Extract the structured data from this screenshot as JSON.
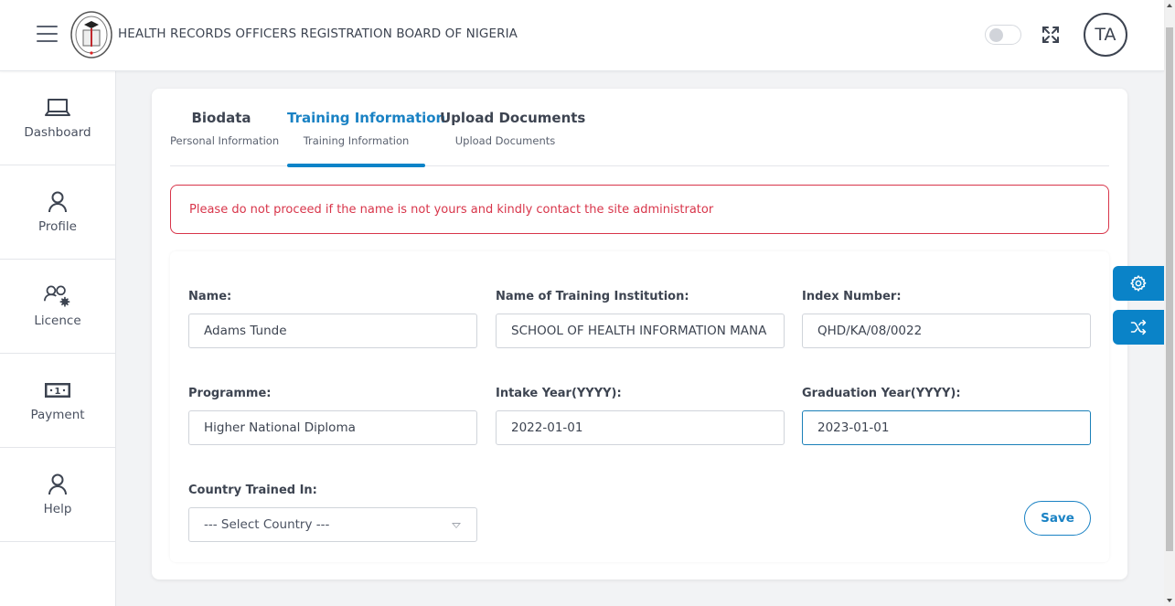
{
  "header": {
    "title": "HEALTH RECORDS OFFICERS REGISTRATION BOARD OF NIGERIA",
    "menu_icon": "hamburger-icon",
    "logo": "board-seal-logo",
    "theme_toggle": "off",
    "fullscreen_icon": "expand-icon",
    "avatar_initials": "TA"
  },
  "sidebar": {
    "items": [
      {
        "label": "Dashboard",
        "icon": "laptop-icon"
      },
      {
        "label": "Profile",
        "icon": "user-icon"
      },
      {
        "label": "Licence",
        "icon": "users-gear-icon"
      },
      {
        "label": "Payment",
        "icon": "banknote-icon"
      },
      {
        "label": "Help",
        "icon": "user-icon"
      }
    ]
  },
  "tabs": [
    {
      "title": "Biodata",
      "subtitle": "Personal Information",
      "active": false
    },
    {
      "title": "Training Information",
      "subtitle": "Training Information",
      "active": true
    },
    {
      "title": "Upload Documents",
      "subtitle": "Upload Documents",
      "active": false
    }
  ],
  "alert": {
    "message": "Please do not proceed if the name is not yours and kindly contact the site administrator"
  },
  "form": {
    "name": {
      "label": "Name:",
      "value": "Adams Tunde"
    },
    "institution": {
      "label": "Name of Training Institution:",
      "value": "SCHOOL OF HEALTH INFORMATION MANA"
    },
    "index_number": {
      "label": "Index Number:",
      "value": "QHD/KA/08/0022"
    },
    "programme": {
      "label": "Programme:",
      "value": "Higher National Diploma"
    },
    "intake_year": {
      "label": "Intake Year(YYYY):",
      "value": "2022-01-01"
    },
    "graduation_year": {
      "label": "Graduation Year(YYYY):",
      "value": "2023-01-01"
    },
    "country": {
      "label": "Country Trained In:",
      "selected": "--- Select Country ---"
    },
    "save_label": "Save"
  },
  "floating_buttons": [
    {
      "icon": "gear-icon"
    },
    {
      "icon": "shuffle-icon"
    }
  ],
  "colors": {
    "accent": "#0a83c8",
    "alert": "#d8354a",
    "text": "#3d4451"
  }
}
